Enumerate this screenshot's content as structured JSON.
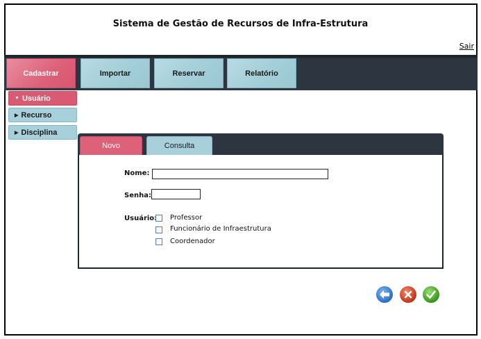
{
  "header": {
    "title": "Sistema de Gestão de Recursos de Infra-Estrutura",
    "logout_label": "Sair"
  },
  "nav": {
    "items": [
      {
        "label": "Cadastrar",
        "active": true
      },
      {
        "label": "Importar",
        "active": false
      },
      {
        "label": "Reservar",
        "active": false
      },
      {
        "label": "Relatório",
        "active": false
      }
    ]
  },
  "sidebar": {
    "items": [
      {
        "label": "Usuário",
        "active": true,
        "icon": "arrow-down-icon"
      },
      {
        "label": "Recurso",
        "active": false,
        "icon": "arrow-right-icon"
      },
      {
        "label": "Disciplina",
        "active": false,
        "icon": "arrow-right-icon"
      }
    ]
  },
  "tabs": [
    {
      "label": "Novo",
      "active": true
    },
    {
      "label": "Consulta",
      "active": false
    }
  ],
  "form": {
    "name_label": "Nome:",
    "name_value": "",
    "password_label": "Senha:",
    "password_value": "",
    "user_type_label": "Usuário:",
    "user_types": [
      {
        "label": "Professor",
        "checked": false
      },
      {
        "label": "Funcionário de Infraestrutura",
        "checked": false
      },
      {
        "label": "Coordenador",
        "checked": false
      }
    ]
  },
  "actions": [
    {
      "icon": "back-arrow-icon",
      "color": "#2f74c8"
    },
    {
      "icon": "cancel-x-icon",
      "color": "#c53a1f"
    },
    {
      "icon": "confirm-check-icon",
      "color": "#3c9a1c"
    }
  ],
  "colors": {
    "navbar_bg": "#2d3540",
    "active_tab": "#dc6179",
    "inactive_tab": "#a7d0da"
  }
}
